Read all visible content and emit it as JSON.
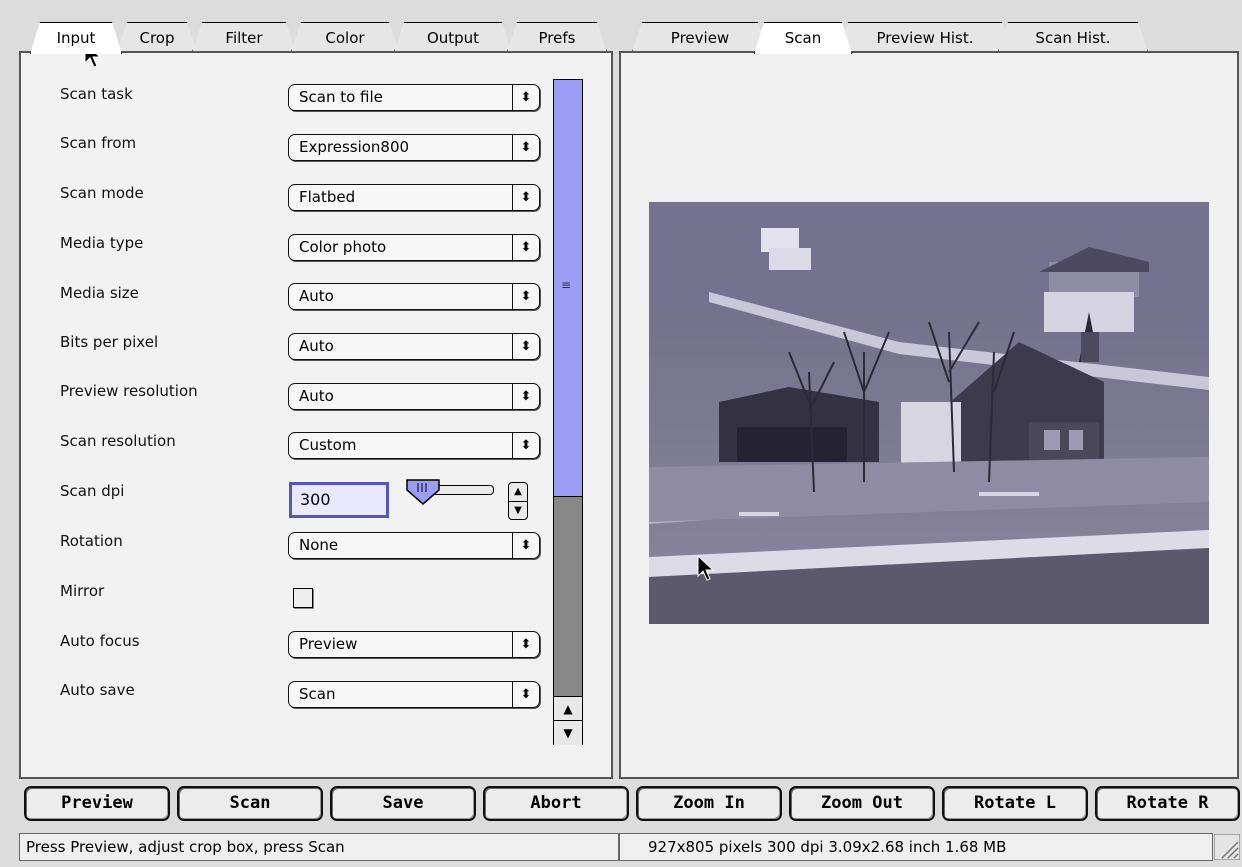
{
  "left_tabs": [
    {
      "label": "Input",
      "active": true
    },
    {
      "label": "Crop",
      "active": false
    },
    {
      "label": "Filter",
      "active": false
    },
    {
      "label": "Color",
      "active": false
    },
    {
      "label": "Output",
      "active": false
    },
    {
      "label": "Prefs",
      "active": false
    }
  ],
  "right_tabs": [
    {
      "label": "Preview",
      "active": false
    },
    {
      "label": "Scan",
      "active": true
    },
    {
      "label": "Preview Hist.",
      "active": false
    },
    {
      "label": "Scan Hist.",
      "active": false
    }
  ],
  "form": {
    "scan_task": {
      "label": "Scan task",
      "value": "Scan to file"
    },
    "scan_from": {
      "label": "Scan from",
      "value": "Expression800"
    },
    "scan_mode": {
      "label": "Scan mode",
      "value": "Flatbed"
    },
    "media_type": {
      "label": "Media type",
      "value": "Color photo"
    },
    "media_size": {
      "label": "Media size",
      "value": "Auto"
    },
    "bits_per_pixel": {
      "label": "Bits per pixel",
      "value": "Auto"
    },
    "preview_resolution": {
      "label": "Preview resolution",
      "value": "Auto"
    },
    "scan_resolution": {
      "label": "Scan resolution",
      "value": "Custom"
    },
    "scan_dpi": {
      "label": "Scan dpi",
      "value": "300"
    },
    "rotation": {
      "label": "Rotation",
      "value": "None"
    },
    "mirror": {
      "label": "Mirror",
      "checked": false
    },
    "auto_focus": {
      "label": "Auto focus",
      "value": "Preview"
    },
    "auto_save": {
      "label": "Auto save",
      "value": "Scan"
    }
  },
  "buttons": {
    "preview": "Preview",
    "scan": "Scan",
    "save": "Save",
    "abort": "Abort",
    "zoom_in": "Zoom In",
    "zoom_out": "Zoom Out",
    "rotate_l": "Rotate L",
    "rotate_r": "Rotate R"
  },
  "status": {
    "message": "Press Preview, adjust crop box, press Scan",
    "image_info": "927x805 pixels 300 dpi 3.09x2.68 inch 1.68 MB"
  },
  "colors": {
    "highlight": "#9d9df5",
    "field_border": "#5757b9"
  }
}
